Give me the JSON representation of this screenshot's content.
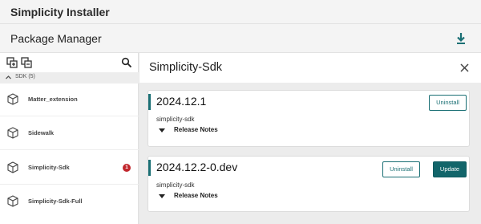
{
  "app": {
    "title": "Simplicity Installer"
  },
  "package_manager": {
    "title": "Package Manager",
    "download_icon": "download-icon"
  },
  "sidebar": {
    "toolbar_icons": [
      "expand-all-icon",
      "collapse-all-icon",
      "search-icon"
    ],
    "section_label": "SDK (5)",
    "items": [
      {
        "name": "Matter_extension",
        "badge": ""
      },
      {
        "name": "Sidewalk",
        "badge": ""
      },
      {
        "name": "Simplicity-Sdk",
        "badge": "1"
      },
      {
        "name": "Simplicity-Sdk-Full",
        "badge": ""
      }
    ]
  },
  "detail": {
    "title": "Simplicity-Sdk",
    "versions": [
      {
        "version": "2024.12.1",
        "package": "simplicity-sdk",
        "release_notes": "Release Notes",
        "uninstall": "Uninstall"
      },
      {
        "version": "2024.12.2-0.dev",
        "package": "simplicity-sdk",
        "release_notes": "Release Notes",
        "uninstall": "Uninstall",
        "update": "Update"
      }
    ]
  },
  "colors": {
    "accent": "#1a6f74",
    "badge": "#c1272d"
  }
}
